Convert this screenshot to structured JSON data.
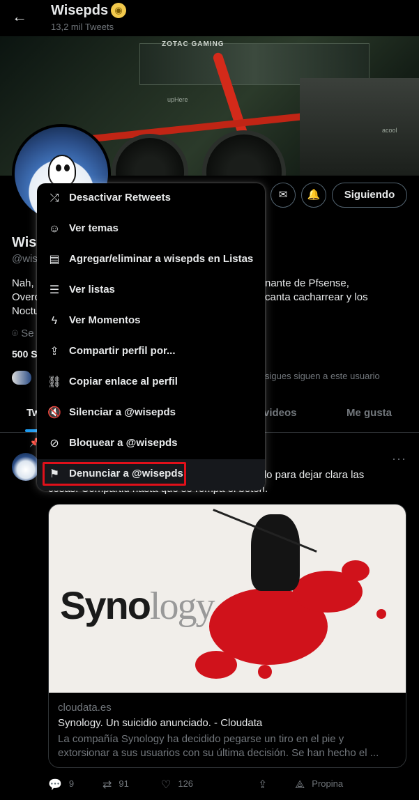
{
  "header": {
    "back_icon": "arrow-left-icon",
    "title": "Wisepds",
    "subtitle": "13,2 mil Tweets",
    "badge_glyph": "◉"
  },
  "banner": {
    "gpu_label": "ZOTAC GAMING",
    "label_uphere": "upHere",
    "label_brand": "acool"
  },
  "profile": {
    "name": "Wis",
    "handle": "@wis",
    "bio_left_1": "Nah,",
    "bio_right_1": "nante de Pfsense,",
    "bio_left_2": "Overc",
    "bio_right_2": "canta cacharrear y los",
    "bio_left_3": "Noctu",
    "location_partial": "Se",
    "stats_partial": "500 S",
    "followed_by_partial": "sigues siguen a este usuario"
  },
  "buttons": {
    "follow_label": "Siguiendo",
    "message_icon": "envelope-icon",
    "notify_icon": "bell-plus-icon"
  },
  "tabs": [
    {
      "label": "Tw"
    },
    {
      "label": "videos"
    },
    {
      "label": "Me gusta"
    }
  ],
  "tweet": {
    "text_line1_right": "culo para dejar clara las",
    "text_line2": "cosas. Compartid hasta que se rompa el botón.",
    "more_label": "···",
    "card": {
      "brand_a": "Syno",
      "brand_b": "logy",
      "domain": "cloudata.es",
      "title": "Synology. Un suicidio anunciado. - Cloudata",
      "description": "La compañía Synology ha decidido pegarse un tiro en el pie y extorsionar a sus usuarios con su última decisión. Se han hecho el ..."
    },
    "actions": {
      "replies": "9",
      "retweets": "91",
      "likes": "126",
      "tip_label": "Propina"
    }
  },
  "menu": {
    "items": [
      {
        "label": "Desactivar Retweets",
        "icon": "retweet-off-icon"
      },
      {
        "label": "Ver temas",
        "icon": "topics-icon"
      },
      {
        "label": "Agregar/eliminar a wisepds en Listas",
        "icon": "list-add-icon"
      },
      {
        "label": "Ver listas",
        "icon": "list-icon"
      },
      {
        "label": "Ver Momentos",
        "icon": "lightning-icon"
      },
      {
        "label": "Compartir perfil por...",
        "icon": "share-icon"
      },
      {
        "label": "Copiar enlace al perfil",
        "icon": "link-icon"
      },
      {
        "label": "Silenciar a @wisepds",
        "icon": "mute-icon"
      },
      {
        "label": "Bloquear a @wisepds",
        "icon": "block-icon"
      },
      {
        "label": "Denunciar a @wisepds",
        "icon": "flag-icon"
      }
    ],
    "highlight_color": "#e0101a"
  },
  "colors": {
    "accent": "#1d9bf0",
    "muted": "#71767b",
    "background": "#000000"
  }
}
